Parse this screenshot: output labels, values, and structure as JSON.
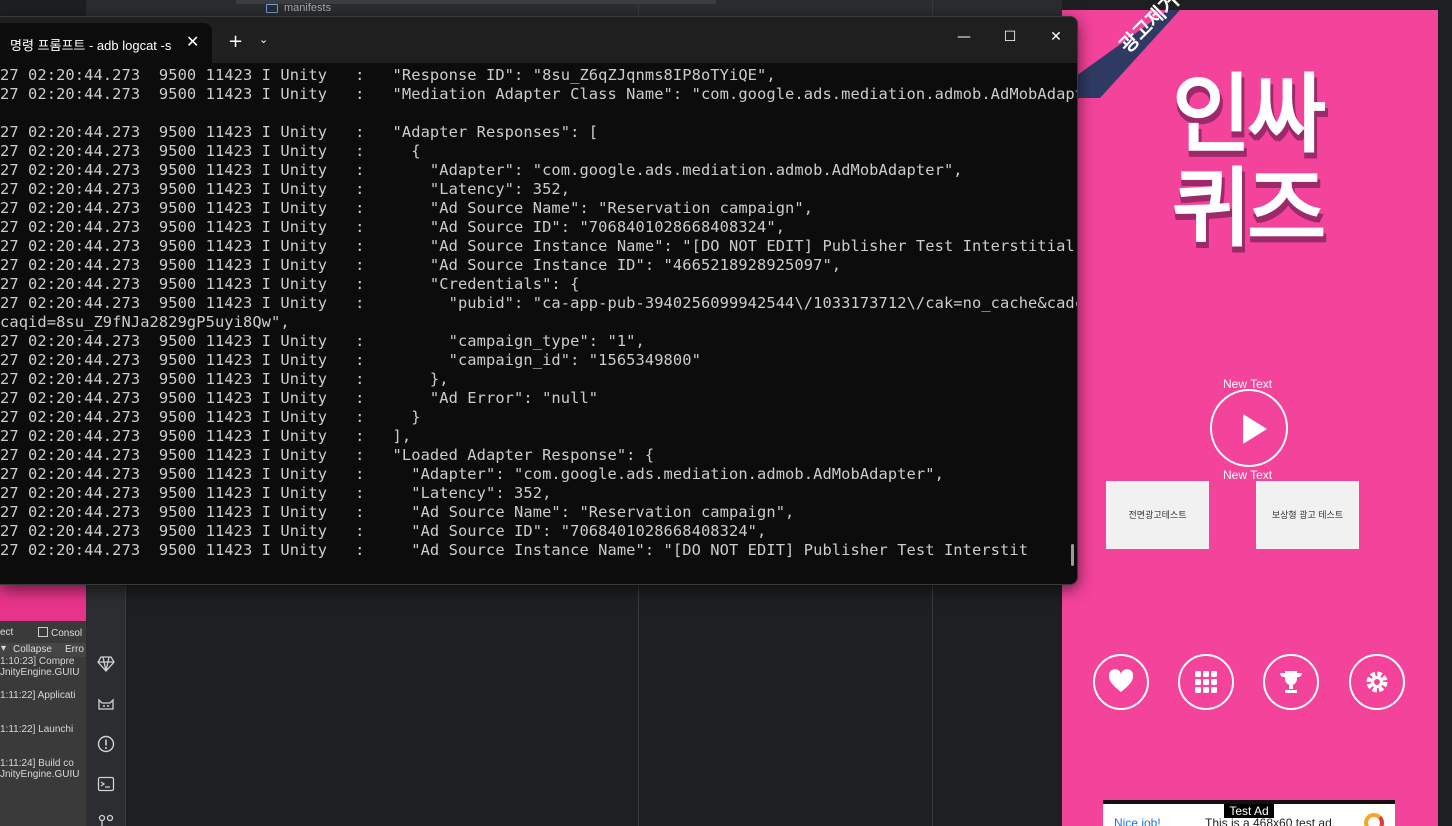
{
  "ide": {
    "tree_item": "manifests",
    "left_tool_icons": [
      "gem-icon",
      "cat-icon",
      "alert-icon",
      "terminal-icon",
      "git-icon"
    ]
  },
  "unity_console": {
    "tab_project": "ect",
    "tab_console": "Consol",
    "collapse": "Collapse",
    "error": "Erro",
    "logs": [
      {
        "l1": "1:10:23] Compre",
        "l2": "JnityEngine.GUIU"
      },
      {
        "l1": "1:11:22] Applicati",
        "l2": ""
      },
      {
        "l1": "1:11:22] Launchi",
        "l2": ""
      },
      {
        "l1": "1:11:24] Build co",
        "l2": "JnityEngine.GUIU"
      }
    ]
  },
  "terminal": {
    "tab_title": "명령 프롬프트 - adb  logcat -s",
    "close_tab": "✕",
    "new_tab": "+",
    "dropdown": "⌄",
    "minimize": "—",
    "maximize": "☐",
    "close": "✕",
    "lines": [
      "27 02:20:44.273  9500 11423 I Unity   :   \"Response ID\": \"8su_Z6qZJqnms8IP8oTYiQE\",",
      "27 02:20:44.273  9500 11423 I Unity   :   \"Mediation Adapter Class Name\": \"com.google.ads.mediation.admob.AdMobAdapte",
      "",
      "27 02:20:44.273  9500 11423 I Unity   :   \"Adapter Responses\": [",
      "27 02:20:44.273  9500 11423 I Unity   :     {",
      "27 02:20:44.273  9500 11423 I Unity   :       \"Adapter\": \"com.google.ads.mediation.admob.AdMobAdapter\",",
      "27 02:20:44.273  9500 11423 I Unity   :       \"Latency\": 352,",
      "27 02:20:44.273  9500 11423 I Unity   :       \"Ad Source Name\": \"Reservation campaign\",",
      "27 02:20:44.273  9500 11423 I Unity   :       \"Ad Source ID\": \"7068401028668408324\",",
      "27 02:20:44.273  9500 11423 I Unity   :       \"Ad Source Instance Name\": \"[DO NOT EDIT] Publisher Test Interstitial\",",
      "27 02:20:44.273  9500 11423 I Unity   :       \"Ad Source Instance ID\": \"4665218928925097\",",
      "27 02:20:44.273  9500 11423 I Unity   :       \"Credentials\": {",
      "27 02:20:44.273  9500 11423 I Unity   :         \"pubid\": \"ca-app-pub-3940256099942544\\/1033173712\\/cak=no_cache&cadc=",
      "caqid=8su_Z9fNJa2829gP5uyi8Qw\",",
      "27 02:20:44.273  9500 11423 I Unity   :         \"campaign_type\": \"1\",",
      "27 02:20:44.273  9500 11423 I Unity   :         \"campaign_id\": \"1565349800\"",
      "27 02:20:44.273  9500 11423 I Unity   :       },",
      "27 02:20:44.273  9500 11423 I Unity   :       \"Ad Error\": \"null\"",
      "27 02:20:44.273  9500 11423 I Unity   :     }",
      "27 02:20:44.273  9500 11423 I Unity   :   ],",
      "27 02:20:44.273  9500 11423 I Unity   :   \"Loaded Adapter Response\": {",
      "27 02:20:44.273  9500 11423 I Unity   :     \"Adapter\": \"com.google.ads.mediation.admob.AdMobAdapter\",",
      "27 02:20:44.273  9500 11423 I Unity   :     \"Latency\": 352,",
      "27 02:20:44.273  9500 11423 I Unity   :     \"Ad Source Name\": \"Reservation campaign\",",
      "27 02:20:44.273  9500 11423 I Unity   :     \"Ad Source ID\": \"7068401028668408324\",",
      "27 02:20:44.273  9500 11423 I Unity   :     \"Ad Source Instance Name\": \"[DO NOT EDIT] Publisher Test Interstit"
    ]
  },
  "game": {
    "ribbon_text": "광고제거",
    "logo_line1": "인싸",
    "logo_line2": "퀴즈",
    "new_text_top": "New Text",
    "new_text_bottom": "New Text",
    "btn_interstitial": "전면광고테스트",
    "btn_rewarded": "보상형 광고 테스트",
    "ad_label": "Test Ad",
    "ad_nice": "Nice job!",
    "ad_text": "This is a 468x60 test ad.",
    "colors": {
      "background": "#f3439a",
      "ribbon": "#2f3a63",
      "logo_shadow": "#9c2a6a"
    }
  }
}
